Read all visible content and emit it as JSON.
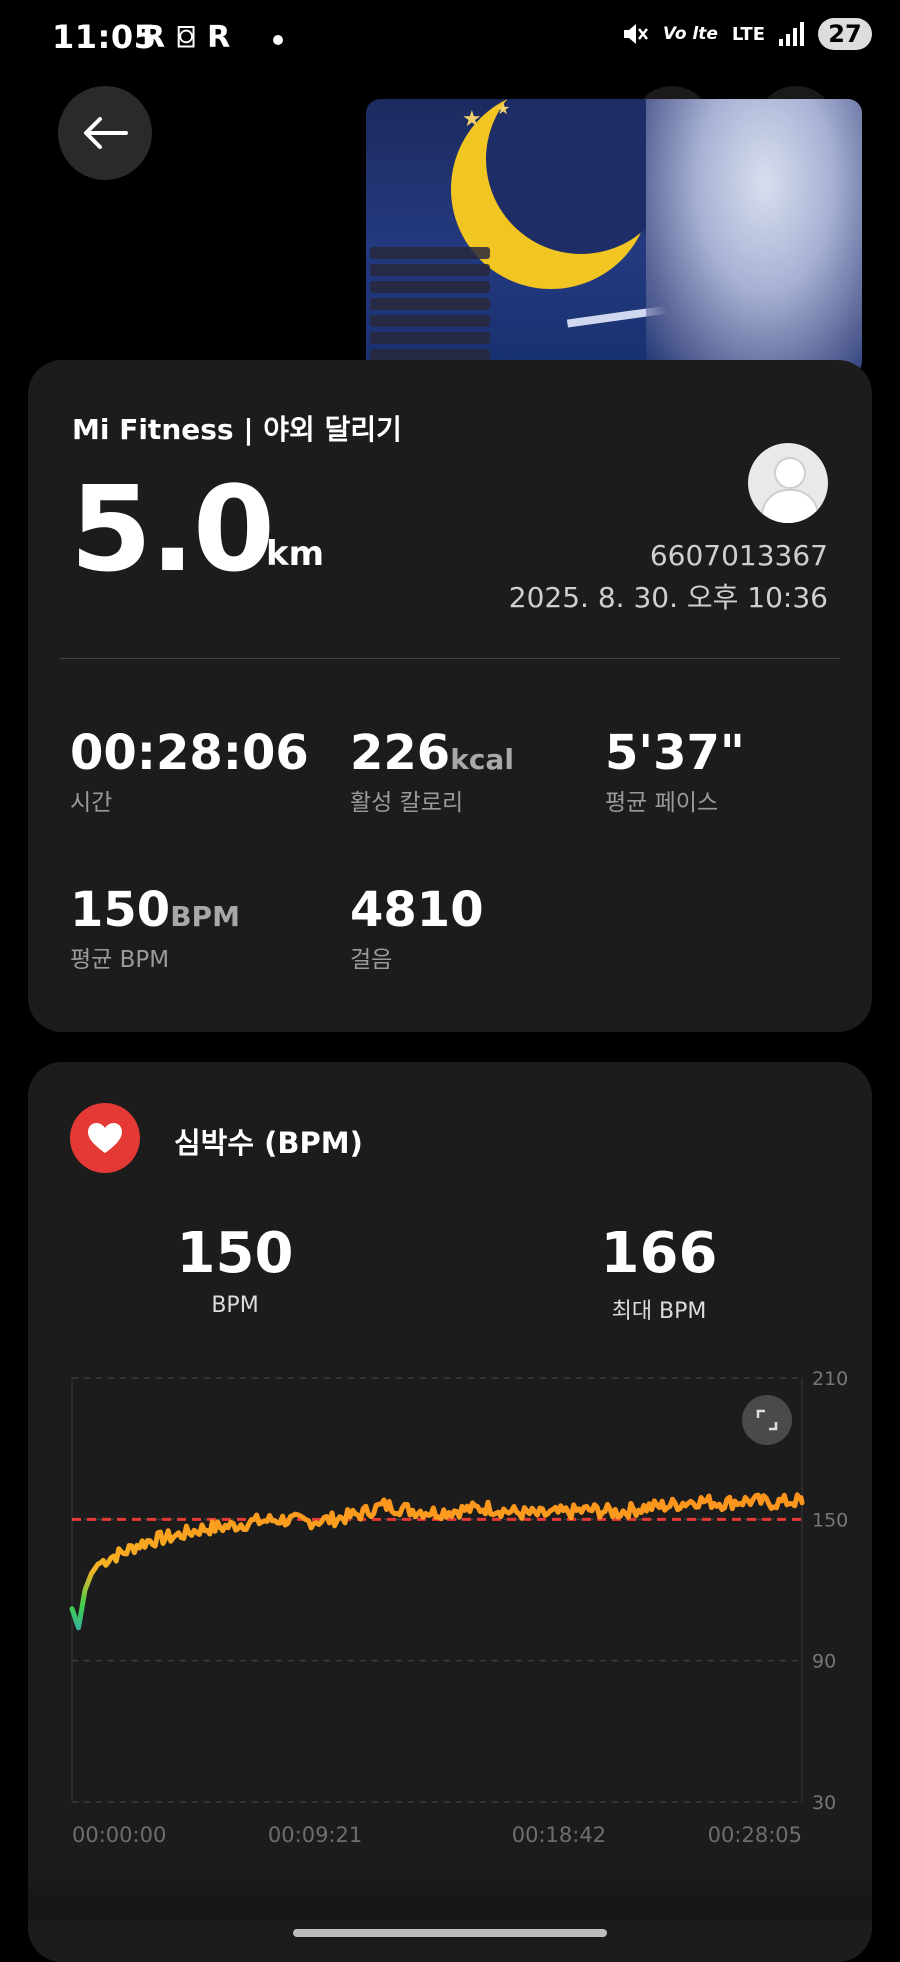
{
  "status_bar": {
    "time": "11:05",
    "app_icons": [
      "R",
      "⌼",
      "R"
    ],
    "network": "LTE",
    "volte": "Vo lte",
    "battery": "27"
  },
  "workout": {
    "title": "Mi Fitness | 야외 달리기",
    "distance_value": "5.0",
    "distance_unit": "km",
    "user_id": "6607013367",
    "datetime": "2025. 8. 30. 오후 10:36",
    "stats": [
      {
        "value": "00:28:06",
        "unit": "",
        "label": "시간"
      },
      {
        "value": "226",
        "unit": "kcal",
        "label": "활성 칼로리"
      },
      {
        "value": "5'37\"",
        "unit": "",
        "label": "평균 페이스"
      },
      {
        "value": "150",
        "unit": "BPM",
        "label": "평균 BPM"
      },
      {
        "value": "4810",
        "unit": "",
        "label": "걸음"
      }
    ]
  },
  "heart_rate": {
    "title": "심박수 (BPM)",
    "avg_value": "150",
    "avg_label": "BPM",
    "max_value": "166",
    "max_label": "최대 BPM"
  },
  "chart_data": {
    "type": "line",
    "ylim": [
      30,
      210
    ],
    "yticks": [
      "210",
      "150",
      "90",
      "30"
    ],
    "xticks": [
      "00:00:00",
      "00:09:21",
      "00:18:42",
      "00:28:05"
    ],
    "reference_line": 150,
    "grid": true,
    "series": [
      {
        "x_minutes": [
          0,
          0.25,
          0.5,
          0.75,
          1,
          1.5,
          2,
          2.5,
          3,
          3.5,
          4,
          5,
          6,
          7,
          8,
          9,
          10,
          11,
          12,
          13,
          14,
          15,
          16,
          17,
          18,
          19,
          20,
          21,
          22,
          23,
          24,
          25,
          26,
          27,
          28,
          28.08
        ],
        "values": [
          112,
          104,
          120,
          127,
          131,
          134,
          136,
          139,
          141,
          142,
          143,
          146,
          147,
          149,
          150,
          149,
          150,
          152,
          156,
          154,
          153,
          154,
          155,
          153,
          152,
          153,
          154,
          153,
          155,
          156,
          158,
          157,
          158,
          157,
          158,
          157
        ]
      }
    ],
    "colors": {
      "low": "#2f8cff",
      "mid": "#3fcf4f",
      "high": "#f6b224",
      "peak": "#ff8c1a",
      "reference": "#e53935"
    }
  }
}
